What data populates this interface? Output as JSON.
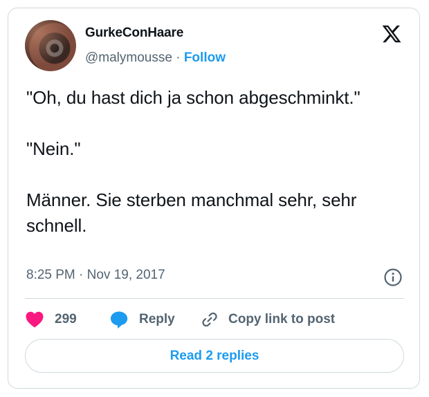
{
  "tweet": {
    "author_name": "GurkeConHaare",
    "handle": "@malymousse",
    "separator": " · ",
    "follow_label": "Follow",
    "text": "\"Oh, du hast dich ja schon abgeschminkt.\"\n\n\"Nein.\"\n\nMänner. Sie sterben manchmal sehr, sehr schnell.",
    "timestamp": "8:25 PM · Nov 19, 2017",
    "like_count": "299",
    "reply_label": "Reply",
    "copy_link_label": "Copy link to post",
    "read_replies_label": "Read 2 replies"
  },
  "icons": {
    "brand": "x-logo-icon",
    "info": "info-icon",
    "like": "heart-icon",
    "reply": "speech-bubble-icon",
    "copy": "link-icon"
  },
  "colors": {
    "accent": "#1d9bf0",
    "like": "#f91880",
    "secondary_text": "#536471",
    "border": "#cfd9de"
  }
}
